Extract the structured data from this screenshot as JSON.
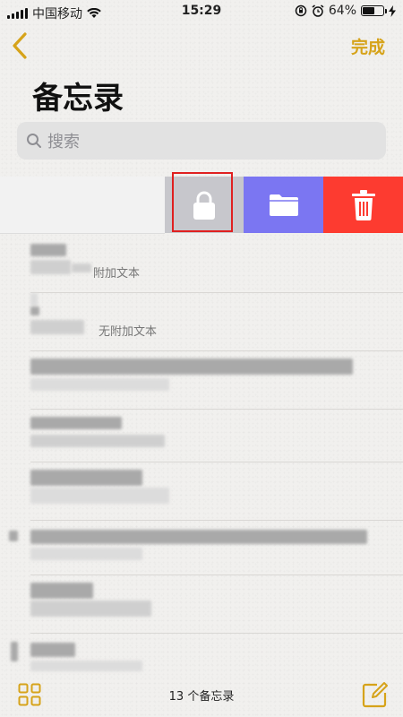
{
  "status_bar": {
    "carrier": "中国移动",
    "time": "15:29",
    "battery_percent": "64%",
    "battery_level": 0.64
  },
  "nav": {
    "done_label": "完成"
  },
  "page": {
    "title": "备忘录"
  },
  "search": {
    "placeholder": "搜索"
  },
  "swipe_actions": [
    "lock",
    "move-to-folder",
    "delete"
  ],
  "notes": [
    {
      "subtitle": "附加文本"
    },
    {
      "subtitle": "无附加文本"
    },
    {
      "subtitle": ""
    },
    {
      "subtitle": ""
    },
    {
      "subtitle": ""
    },
    {
      "subtitle": ""
    },
    {
      "subtitle": ""
    },
    {
      "subtitle": ""
    }
  ],
  "toolbar": {
    "note_count": "13 个备忘录"
  },
  "colors": {
    "accent": "#d6a31a",
    "lock_bg": "#c7c7cc",
    "folder_bg": "#7b76f2",
    "delete_bg": "#fd3b30",
    "highlight": "#e02020"
  }
}
